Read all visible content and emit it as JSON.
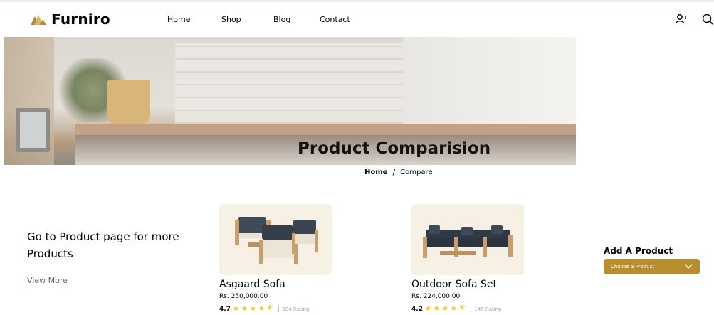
{
  "brand": {
    "name": "Furniro",
    "accent": "#B88E2F"
  },
  "nav": {
    "items": [
      {
        "label": "Home"
      },
      {
        "label": "Shop"
      },
      {
        "label": "Blog"
      },
      {
        "label": "Contact"
      }
    ]
  },
  "header_icons": [
    "user-icon",
    "search-icon"
  ],
  "hero": {
    "title": "Product Comparision"
  },
  "breadcrumb": {
    "home": "Home",
    "separator": "/",
    "current": "Compare"
  },
  "sidebar_cta": {
    "title": "Go to Product page for more Products",
    "link": "View More"
  },
  "products": [
    {
      "name": "Asgaard Sofa",
      "price": "Rs. 250,000.00",
      "rating": "4.7",
      "stars": 4.5,
      "rating_count": "204 Rating"
    },
    {
      "name": "Outdoor Sofa Set",
      "price": "Rs. 224,000.00",
      "rating": "4.2",
      "stars": 4.5,
      "rating_count": "145 Rating"
    }
  ],
  "add_product": {
    "label": "Add A Product",
    "placeholder": "Choose a Product"
  }
}
